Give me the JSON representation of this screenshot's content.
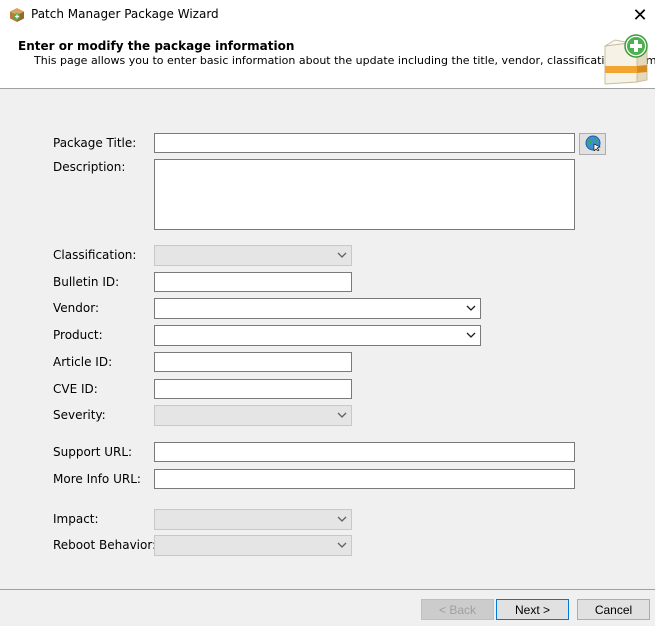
{
  "window": {
    "title": "Patch Manager Package Wizard",
    "close_glyph": "✕"
  },
  "header": {
    "title": "Enter or modify the package information",
    "subtitle": "This page allows you to enter basic information about the update including the title, vendor, classification and more."
  },
  "form": {
    "package_title_label": "Package Title:",
    "package_title_value": "",
    "description_label": "Description:",
    "description_value": "",
    "classification_label": "Classification:",
    "bulletin_id_label": "Bulletin ID:",
    "bulletin_id_value": "",
    "vendor_label": "Vendor:",
    "product_label": "Product:",
    "article_id_label": "Article ID:",
    "article_id_value": "",
    "cve_id_label": "CVE ID:",
    "cve_id_value": "",
    "severity_label": "Severity:",
    "support_url_label": "Support URL:",
    "support_url_value": "",
    "more_info_url_label": "More Info URL:",
    "more_info_url_value": "",
    "impact_label": "Impact:",
    "reboot_behavior_label": "Reboot Behavior:"
  },
  "buttons": {
    "back": "< Back",
    "next": "Next >",
    "cancel": "Cancel"
  },
  "icons": {
    "app": "package-icon",
    "header": "package-add-icon",
    "browse": "globe-icon"
  }
}
